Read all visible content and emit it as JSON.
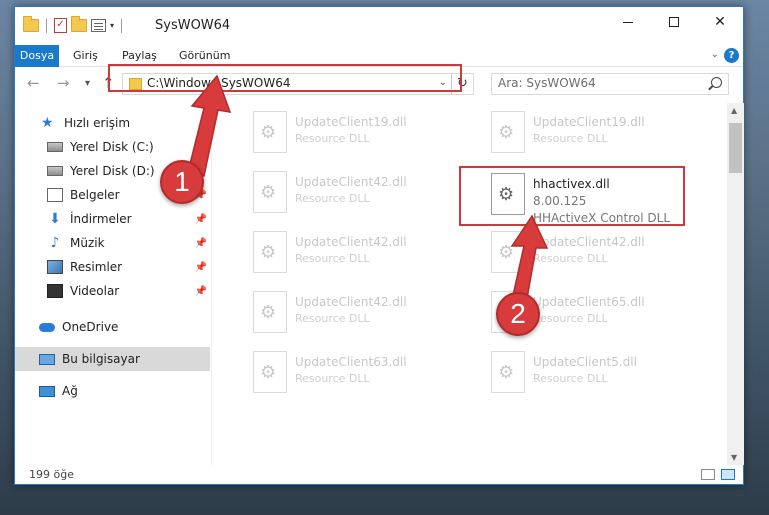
{
  "window": {
    "title": "SysWOW64",
    "minimize": "—",
    "maximize": "",
    "close": "✕"
  },
  "ribbon": {
    "tabs": [
      "Dosya",
      "Giriş",
      "Paylaş",
      "Görünüm"
    ],
    "help": "?"
  },
  "navigation": {
    "back": "←",
    "forward": "→",
    "recent": "▾",
    "up": "↑",
    "address": "C:\\Windows\\SysWOW64",
    "refresh": "↻",
    "search_placeholder": "Ara: SysWOW64"
  },
  "sidebar": {
    "items": [
      {
        "label": "Hızlı erişim",
        "icon": "star-icon"
      },
      {
        "label": "Yerel Disk (C:)",
        "icon": "drive-icon",
        "pinned": true
      },
      {
        "label": "Yerel Disk (D:)",
        "icon": "drive-icon",
        "pinned": true
      },
      {
        "label": "Belgeler",
        "icon": "documents-icon",
        "pinned": true
      },
      {
        "label": "İndirmeler",
        "icon": "download-icon",
        "pinned": true
      },
      {
        "label": "Müzik",
        "icon": "music-icon",
        "pinned": true
      },
      {
        "label": "Resimler",
        "icon": "pictures-icon",
        "pinned": true
      },
      {
        "label": "Videolar",
        "icon": "videos-icon",
        "pinned": true
      },
      {
        "label": "OneDrive",
        "icon": "onedrive-icon"
      },
      {
        "label": "Bu bilgisayar",
        "icon": "this-pc-icon",
        "selected": true
      },
      {
        "label": "Ağ",
        "icon": "network-icon"
      }
    ]
  },
  "files": {
    "left_column": [
      {
        "name": "UpdateClient19.dll",
        "desc": "Resource DLL"
      },
      {
        "name": "UpdateClient42.dll",
        "desc": "Resource DLL"
      },
      {
        "name": "UpdateClient42.dll",
        "desc": "Resource DLL"
      },
      {
        "name": "UpdateClient42.dll",
        "desc": "Resource DLL"
      },
      {
        "name": "UpdateClient63.dll",
        "desc": "Resource DLL"
      }
    ],
    "right_column": [
      {
        "name": "UpdateClient19.dll",
        "desc": "Resource DLL"
      },
      {
        "name": "hhactivex.dll",
        "version": "8.00.125",
        "desc": "HHActiveX Control DLL",
        "active": true
      },
      {
        "name": "UpdateClient42.dll",
        "desc": "Resource DLL"
      },
      {
        "name": "UpdateClient65.dll",
        "desc": "Resource DLL"
      },
      {
        "name": "UpdateClient5.dll",
        "desc": "Resource DLL"
      }
    ]
  },
  "status": {
    "item_count": "199 öğe"
  },
  "callouts": [
    "1",
    "2"
  ],
  "colors": {
    "accent": "#1979ca",
    "highlight": "#d0393a",
    "callout": "#d83b3b"
  }
}
